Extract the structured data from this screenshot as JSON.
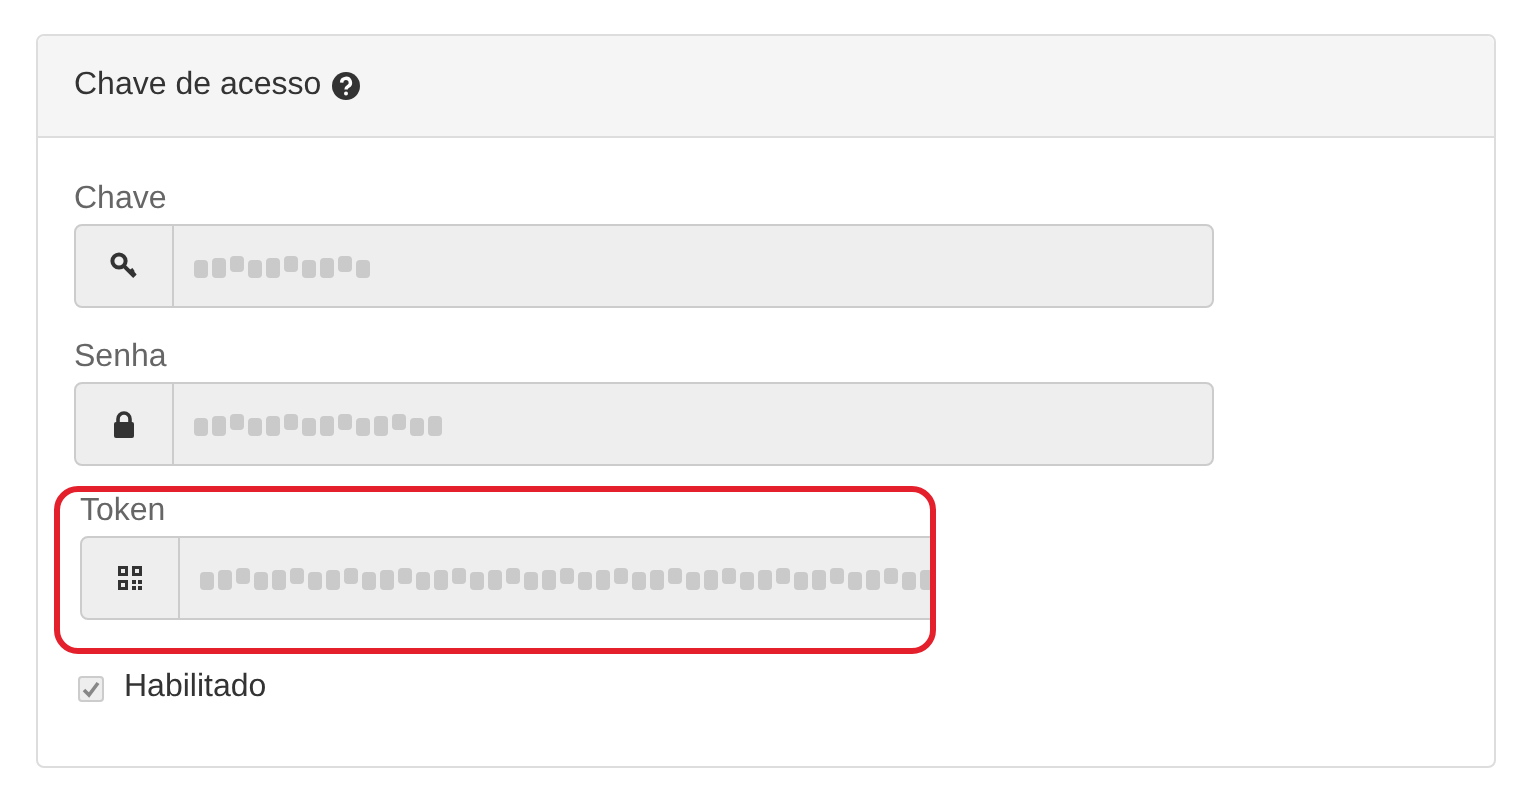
{
  "panel": {
    "title": "Chave de acesso"
  },
  "fields": [
    {
      "label": "Chave",
      "kind": "key",
      "disabled": true,
      "redacted": true,
      "highlighted": false
    },
    {
      "label": "Senha",
      "kind": "lock",
      "disabled": true,
      "redacted": true,
      "highlighted": false
    },
    {
      "label": "Token",
      "kind": "qrcode",
      "disabled": true,
      "redacted": true,
      "highlighted": true
    }
  ],
  "enabled_checkbox": {
    "label": "Habilitado",
    "checked": true,
    "disabled": true
  }
}
